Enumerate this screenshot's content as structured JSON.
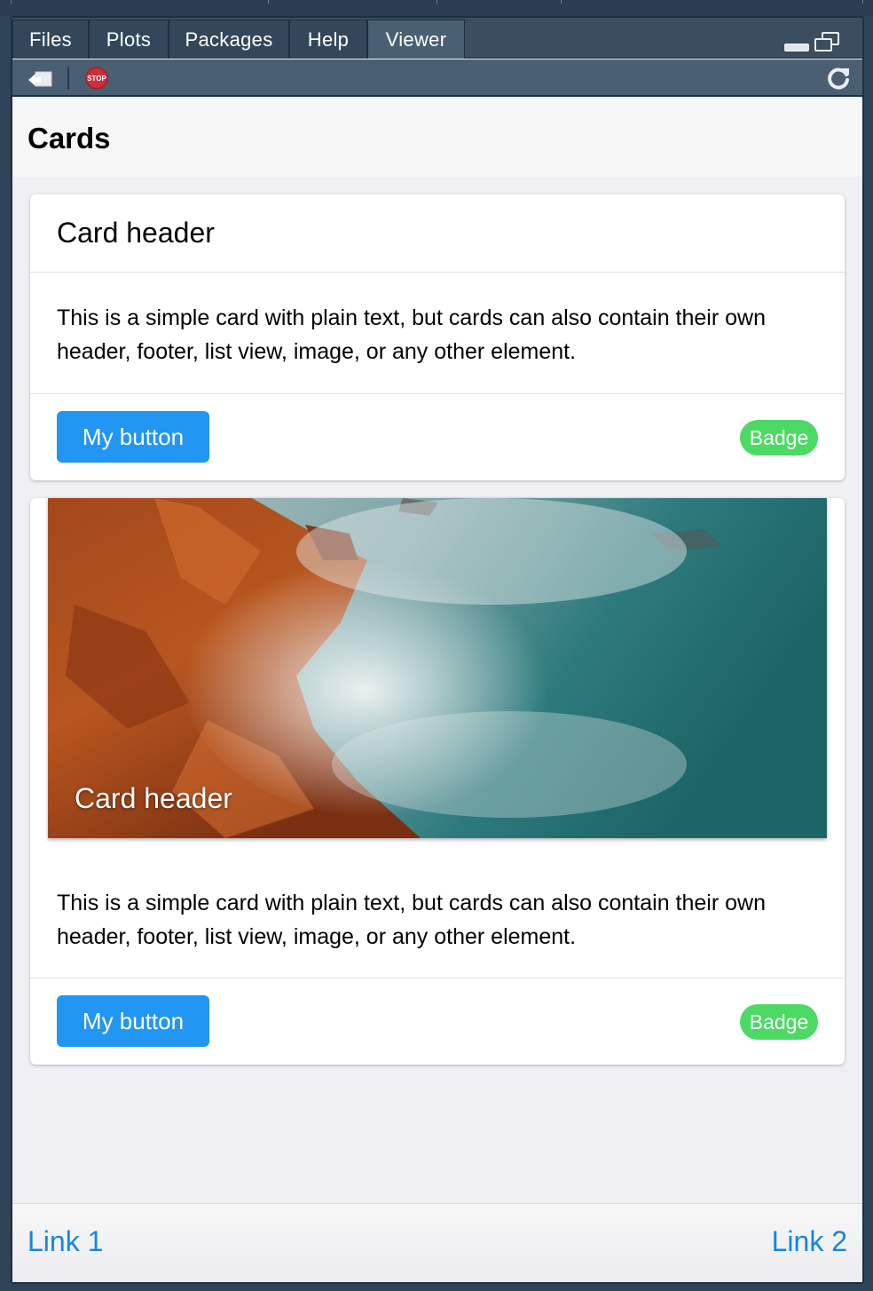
{
  "tabs": [
    {
      "label": "Files"
    },
    {
      "label": "Plots"
    },
    {
      "label": "Packages"
    },
    {
      "label": "Help"
    },
    {
      "label": "Viewer",
      "active": true
    }
  ],
  "toolbar": {
    "stop_label": "STOP",
    "icons": [
      "export-icon",
      "stop-icon",
      "refresh-icon"
    ]
  },
  "page": {
    "title": "Cards"
  },
  "cards": [
    {
      "header": "Card header",
      "content": "This is a simple card with plain text, but cards can also contain their own header, footer, list view, image, or any other element.",
      "button": "My button",
      "badge": "Badge"
    },
    {
      "image_title": "Card header",
      "content": "This is a simple card with plain text, but cards can also contain their own header, footer, list view, image, or any other element.",
      "button": "My button",
      "badge": "Badge"
    }
  ],
  "bottom_links": [
    "Link 1",
    "Link 2"
  ],
  "colors": {
    "accent": "#2196f3",
    "badge": "#4cd964",
    "link": "#1787d8",
    "chrome": "#3b4e60"
  }
}
